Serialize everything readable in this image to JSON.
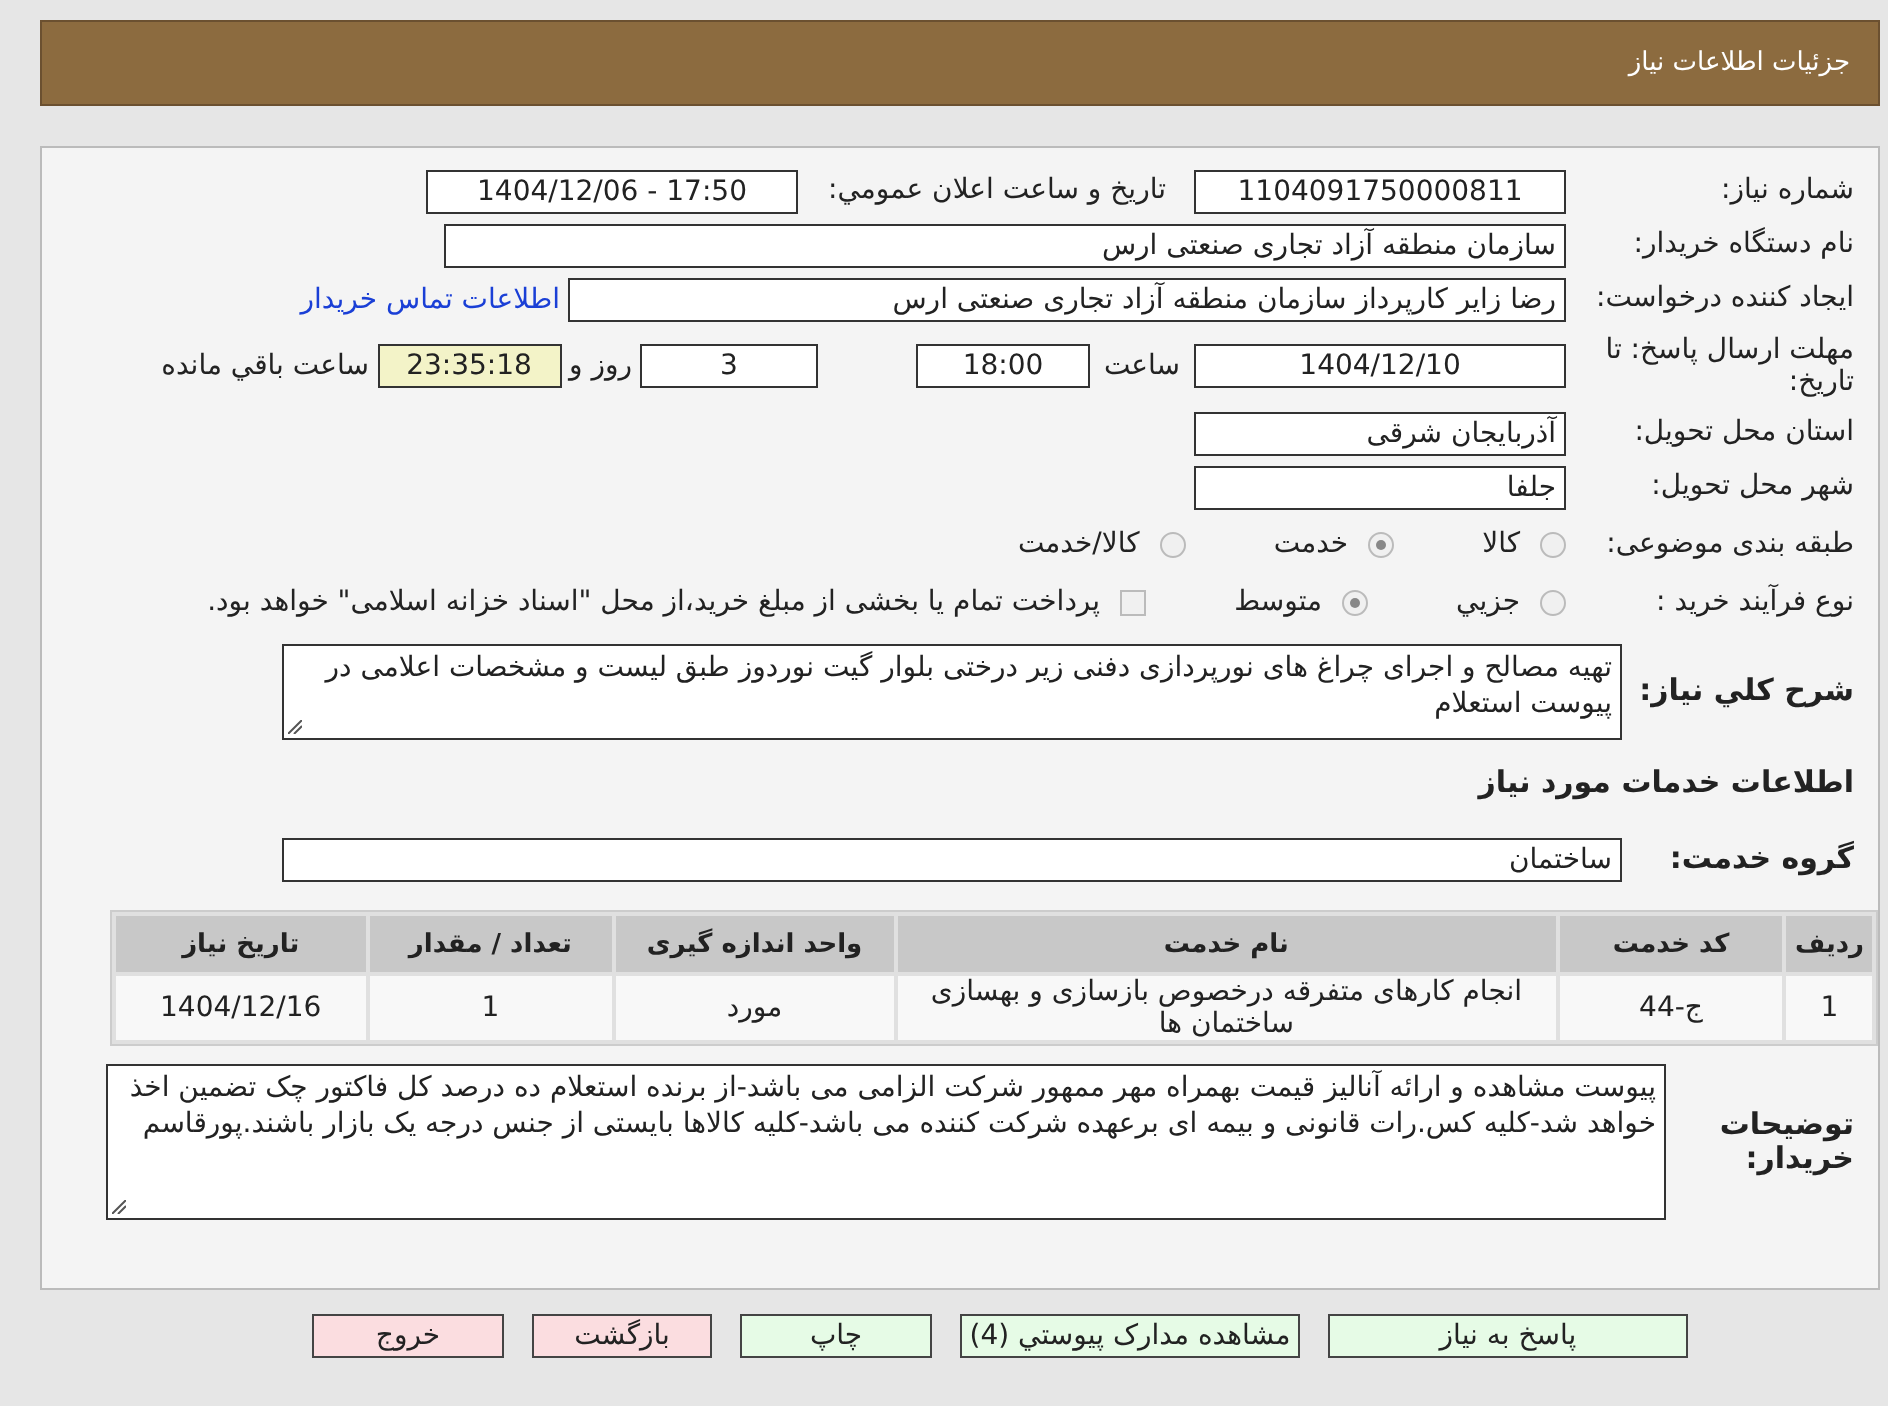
{
  "header": {
    "title": "جزئیات اطلاعات نیاز"
  },
  "need_number": {
    "label": "شماره نیاز:",
    "value": "1104091750000811"
  },
  "announce_datetime": {
    "label": "تاریخ و ساعت اعلان عمومي:",
    "value": "1404/12/06 - 17:50"
  },
  "buyer_org": {
    "label": "نام دستگاه خریدار:",
    "value": "سازمان منطقه آزاد تجاری صنعتی ارس"
  },
  "requester": {
    "label": "ایجاد کننده درخواست:",
    "value": "رضا زایر کارپرداز سازمان منطقه آزاد تجاری صنعتی ارس",
    "link": "اطلاعات تماس خریدار"
  },
  "deadline": {
    "label": "مهلت ارسال پاسخ: تا تاریخ:",
    "date": "1404/12/10",
    "time_label": "ساعت",
    "time": "18:00",
    "days": "3",
    "days_label": "روز و",
    "remaining": "23:35:18",
    "remaining_label": "ساعت باقي مانده"
  },
  "province": {
    "label": "استان محل تحویل:",
    "value": "آذربایجان شرقی"
  },
  "city": {
    "label": "شهر محل تحویل:",
    "value": "جلفا"
  },
  "category": {
    "label": "طبقه بندی موضوعی:",
    "options": [
      {
        "label": "کالا",
        "selected": false
      },
      {
        "label": "خدمت",
        "selected": true
      },
      {
        "label": "کالا/خدمت",
        "selected": false
      }
    ]
  },
  "purchase_type": {
    "label": "نوع فرآیند خرید :",
    "options": [
      {
        "label": "جزيي",
        "selected": false
      },
      {
        "label": "متوسط",
        "selected": true
      }
    ],
    "treasury": {
      "checked": false,
      "text": "پرداخت تمام یا بخشی از مبلغ خرید،از محل \"اسناد خزانه اسلامی\" خواهد بود."
    }
  },
  "description": {
    "label": "شرح کلي نیاز:",
    "value": "تهیه مصالح و اجرای چراغ های نورپردازی دفنی زیر درختی بلوار گیت نوردوز طبق لیست و مشخصات اعلامی در پیوست استعلام"
  },
  "services_title": "اطلاعات خدمات مورد نیاز",
  "service_group": {
    "label": "گروه خدمت:",
    "value": "ساختمان"
  },
  "table": {
    "columns": [
      "ردیف",
      "کد خدمت",
      "نام خدمت",
      "واحد اندازه گیری",
      "تعداد / مقدار",
      "تاریخ نیاز"
    ],
    "rows": [
      [
        "1",
        "ج-44",
        "انجام کارهای متفرقه درخصوص بازسازی و بهسازی ساختمان ها",
        "مورد",
        "1",
        "1404/12/16"
      ]
    ]
  },
  "buyer_notes": {
    "label": "توضیحات خریدار:",
    "value": "پیوست مشاهده و ارائه آنالیز قیمت بهمراه مهر ممهور شرکت الزامی می باشد-از برنده استعلام ده درصد کل فاکتور چک تضمین اخذ خواهد شد-کلیه کس.رات قانونی و بیمه ای برعهده شرکت کننده می باشد-کلیه کالاها بایستی از جنس درجه یک بازار باشند.پورقاسم"
  },
  "buttons": [
    {
      "label": "پاسخ به نیاز",
      "color": "#e6fbe6"
    },
    {
      "label": "مشاهده مدارک پیوستي (4)",
      "color": "#e6fbe6"
    },
    {
      "label": "چاپ",
      "color": "#e6fbe6"
    },
    {
      "label": "بازگشت",
      "color": "#fbdde0"
    },
    {
      "label": "خروج",
      "color": "#fbdde0"
    }
  ]
}
